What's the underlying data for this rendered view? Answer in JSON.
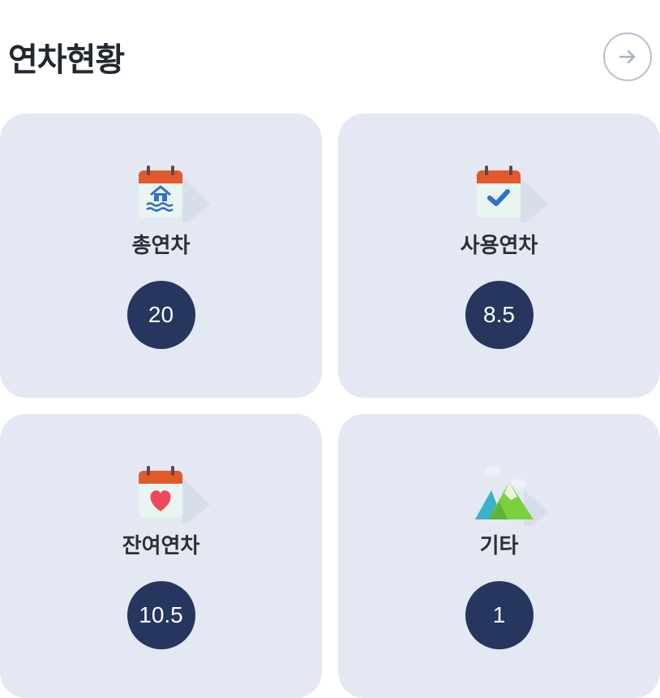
{
  "header": {
    "title": "연차현황",
    "more_icon": "arrow-right-icon"
  },
  "cards": [
    {
      "label": "총연차",
      "value": "20",
      "icon": "calendar-vacation-icon"
    },
    {
      "label": "사용연차",
      "value": "8.5",
      "icon": "calendar-check-icon"
    },
    {
      "label": "잔여연차",
      "value": "10.5",
      "icon": "calendar-heart-icon"
    },
    {
      "label": "기타",
      "value": "1",
      "icon": "mountain-icon"
    }
  ],
  "colors": {
    "card_background": "#e3e8f3",
    "value_badge": "#26365f",
    "calendar_top": "#e2592b",
    "check_blue": "#2f6fd6",
    "heart_red": "#f0485a"
  }
}
